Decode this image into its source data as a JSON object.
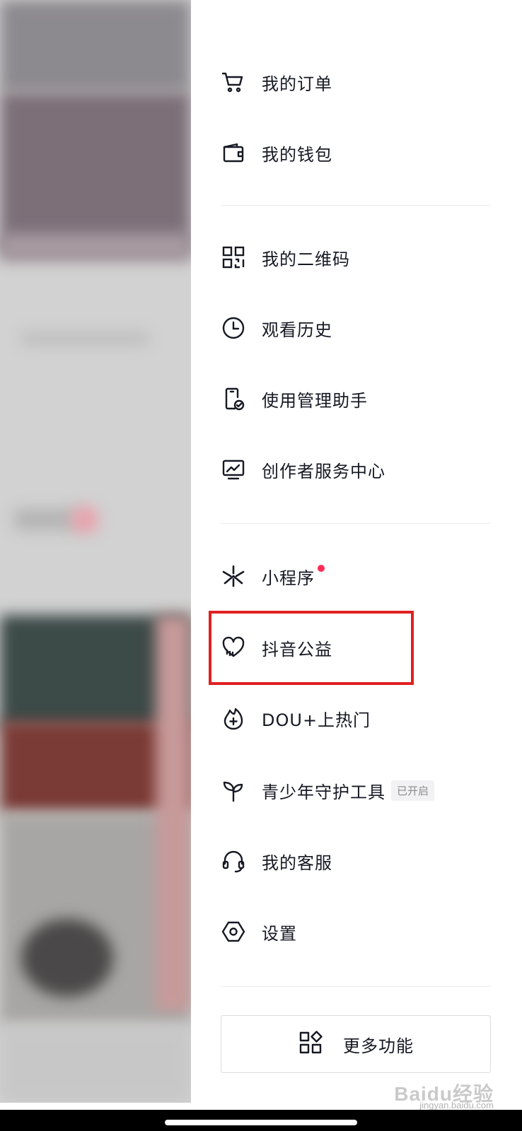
{
  "menu": {
    "orders": "我的订单",
    "wallet": "我的钱包",
    "qrcode": "我的二维码",
    "history": "观看历史",
    "usage_assistant": "使用管理助手",
    "creator_center": "创作者服务中心",
    "mini_programs": "小程序",
    "charity": "抖音公益",
    "dou_plus": "DOU+上热门",
    "youth_protection": "青少年守护工具",
    "youth_protection_status": "已开启",
    "customer_service": "我的客服",
    "settings": "设置"
  },
  "more_features": {
    "label": "更多功能"
  },
  "icons": {
    "orders": "cart-icon",
    "wallet": "wallet-icon",
    "qrcode": "qr-code-icon",
    "history": "clock-icon",
    "usage_assistant": "phone-check-icon",
    "creator_center": "monitor-chart-icon",
    "mini_programs": "asterisk-icon",
    "charity": "heart-icon",
    "dou_plus": "flame-plus-icon",
    "youth_protection": "sprout-icon",
    "customer_service": "headset-icon",
    "settings": "hexagon-gear-icon",
    "more": "grid-diamond-icon"
  },
  "colors": {
    "highlight_border": "#e02020",
    "notification_dot": "#fe2c55",
    "text": "#161823"
  },
  "watermark": {
    "brand": "Baidu经验",
    "url": "jingyan.baidu.com"
  }
}
